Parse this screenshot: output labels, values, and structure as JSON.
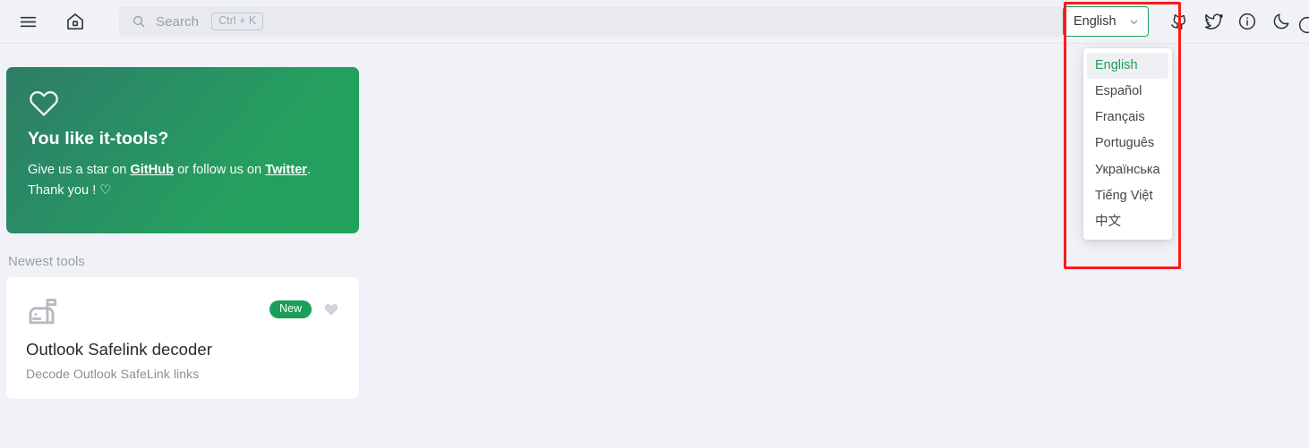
{
  "header": {
    "menu_icon": "hamburger-menu-icon",
    "home_icon": "home-icon",
    "search": {
      "icon": "search-icon",
      "placeholder": "Search",
      "shortcut": "Ctrl + K"
    },
    "language_select": {
      "value": "English",
      "chevron_icon": "chevron-down-icon",
      "accent_color": "#18a058"
    },
    "actions": [
      {
        "name": "github-icon",
        "label": "GitHub"
      },
      {
        "name": "twitter-icon",
        "label": "Twitter"
      },
      {
        "name": "info-icon",
        "label": "About"
      },
      {
        "name": "moon-icon",
        "label": "Dark mode"
      }
    ]
  },
  "language_dropdown": {
    "options": [
      {
        "label": "English",
        "selected": true
      },
      {
        "label": "Español",
        "selected": false
      },
      {
        "label": "Français",
        "selected": false
      },
      {
        "label": "Português",
        "selected": false
      },
      {
        "label": "Українська",
        "selected": false
      },
      {
        "label": "Tiếng Việt",
        "selected": false
      },
      {
        "label": "中文",
        "selected": false
      }
    ],
    "selected_color": "#18a058",
    "selected_bg": "#eef0f3"
  },
  "highlight": {
    "color": "#ff1a1a"
  },
  "promo_card": {
    "heart_icon": "heart-outline-icon",
    "title": "You like it-tools?",
    "text_before_github": "Give us a star on ",
    "github_link": "GitHub",
    "text_between": " or follow us on ",
    "twitter_link": "Twitter",
    "text_after": ".",
    "thanks": "Thank you ! ♡",
    "gradient_from": "#2f7d63",
    "gradient_to": "#21a25c"
  },
  "newest_tools": {
    "section_title": "Newest tools",
    "cards": [
      {
        "icon": "mailbox-icon",
        "badge": "New",
        "favorite_icon": "heart-filled-icon",
        "name": "Outlook Safelink decoder",
        "description": "Decode Outlook SafeLink links"
      }
    ]
  },
  "page": {
    "background": "#f0f2f7"
  }
}
